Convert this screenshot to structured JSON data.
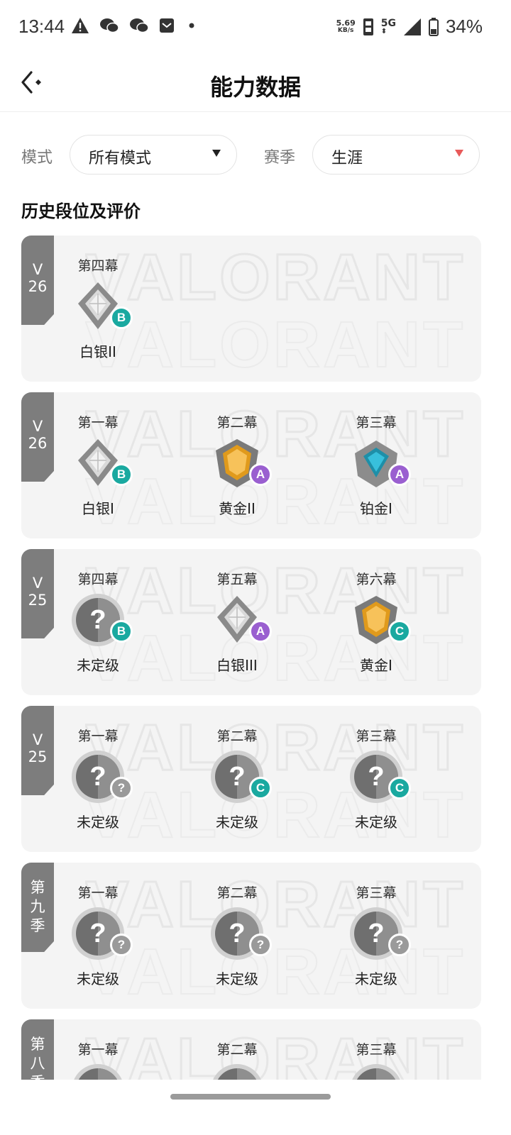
{
  "status": {
    "time": "13:44",
    "net_speed": "5.69",
    "net_unit": "KB/s",
    "network": "5G",
    "battery": "34%"
  },
  "header": {
    "title": "能力数据"
  },
  "filters": {
    "mode_label": "模式",
    "mode_value": "所有模式",
    "season_label": "赛季",
    "season_value": "生涯"
  },
  "section_title": "历史段位及评价",
  "watermark": "VALORANT",
  "cards": [
    {
      "tag": "V\n26",
      "acts": [
        {
          "title": "第四幕",
          "rank": "白银II",
          "emblem": "silver-rank-icon",
          "grade": "B"
        }
      ]
    },
    {
      "tag": "V\n26",
      "acts": [
        {
          "title": "第一幕",
          "rank": "白银I",
          "emblem": "silver-rank-icon",
          "grade": "B"
        },
        {
          "title": "第二幕",
          "rank": "黄金II",
          "emblem": "gold-rank-icon",
          "grade": "A"
        },
        {
          "title": "第三幕",
          "rank": "铂金I",
          "emblem": "platinum-rank-icon",
          "grade": "A"
        }
      ]
    },
    {
      "tag": "V\n25",
      "acts": [
        {
          "title": "第四幕",
          "rank": "未定级",
          "emblem": "unranked-icon",
          "grade": "B"
        },
        {
          "title": "第五幕",
          "rank": "白银III",
          "emblem": "silver-rank-icon",
          "grade": "A"
        },
        {
          "title": "第六幕",
          "rank": "黄金I",
          "emblem": "gold-rank-icon",
          "grade": "C"
        }
      ]
    },
    {
      "tag": "V\n25",
      "acts": [
        {
          "title": "第一幕",
          "rank": "未定级",
          "emblem": "unranked-icon",
          "grade": "?"
        },
        {
          "title": "第二幕",
          "rank": "未定级",
          "emblem": "unranked-icon",
          "grade": "C"
        },
        {
          "title": "第三幕",
          "rank": "未定级",
          "emblem": "unranked-icon",
          "grade": "C"
        }
      ]
    },
    {
      "tag": "第\n九\n季",
      "acts": [
        {
          "title": "第一幕",
          "rank": "未定级",
          "emblem": "unranked-icon",
          "grade": "?"
        },
        {
          "title": "第二幕",
          "rank": "未定级",
          "emblem": "unranked-icon",
          "grade": "?"
        },
        {
          "title": "第三幕",
          "rank": "未定级",
          "emblem": "unranked-icon",
          "grade": "?"
        }
      ]
    },
    {
      "tag": "第\n八\n季",
      "acts": [
        {
          "title": "第一幕",
          "rank": "",
          "emblem": "unranked-icon",
          "grade": ""
        },
        {
          "title": "第二幕",
          "rank": "",
          "emblem": "unranked-icon",
          "grade": ""
        },
        {
          "title": "第三幕",
          "rank": "",
          "emblem": "unranked-icon",
          "grade": ""
        }
      ]
    }
  ]
}
